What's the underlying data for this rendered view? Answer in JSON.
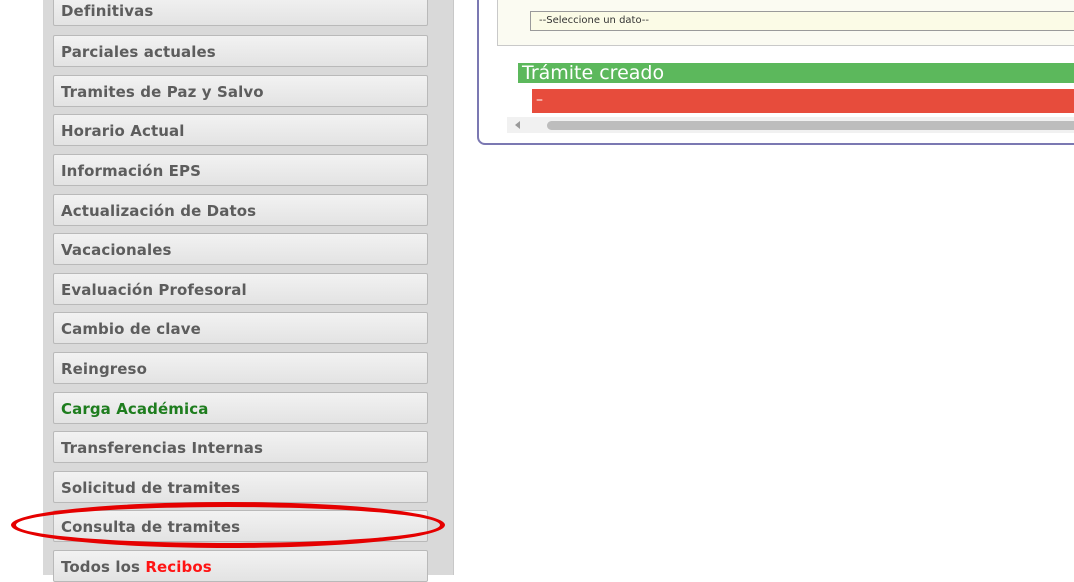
{
  "menu": {
    "items": [
      {
        "label": "Definitivas"
      },
      {
        "label": "Parciales actuales"
      },
      {
        "label": "Tramites de Paz y Salvo"
      },
      {
        "label": "Horario Actual"
      },
      {
        "label": "Información EPS"
      },
      {
        "label": "Actualización de Datos"
      },
      {
        "label": "Vacacionales"
      },
      {
        "label": "Evaluación Profesoral"
      },
      {
        "label": "Cambio de clave"
      },
      {
        "label": "Reingreso"
      },
      {
        "label": "Carga Académica"
      },
      {
        "label": "Transferencias Internas"
      },
      {
        "label": "Solicitud de tramites"
      },
      {
        "label": "Consulta de tramites"
      },
      {
        "label_prefix": "Todos los ",
        "label_highlight": "Recibos"
      }
    ]
  },
  "panel": {
    "select_placeholder": "--Seleccione un dato--",
    "success_message": "Trámite creado",
    "error_message": "–"
  },
  "colors": {
    "success": "#5cb85c",
    "error": "#e74c3c",
    "annotation": "#e50000",
    "active_menu_text": "#1e7d1e"
  }
}
